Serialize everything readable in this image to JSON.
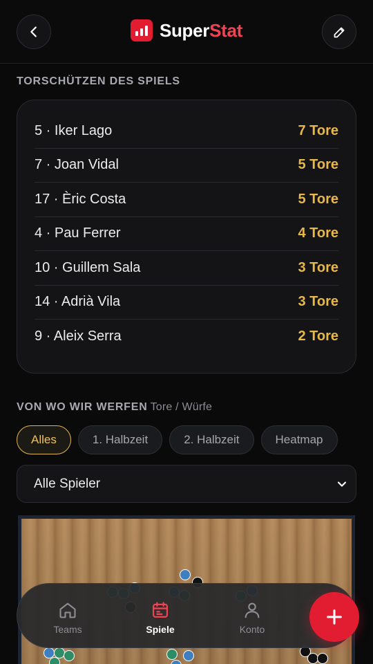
{
  "header": {
    "brand_part1": "Super",
    "brand_part2": "Stat",
    "back_icon": "chevron-left-icon",
    "edit_icon": "pencil-icon",
    "logo_icon": "bar-chart-icon"
  },
  "scorers": {
    "title": "TORSCHÜTZEN DES SPIELS",
    "rows": [
      {
        "player": "5 · Iker Lago",
        "goals": "7 Tore"
      },
      {
        "player": "7 · Joan Vidal",
        "goals": "5 Tore"
      },
      {
        "player": "17 · Èric Costa",
        "goals": "5 Tore"
      },
      {
        "player": "4 · Pau Ferrer",
        "goals": "4 Tore"
      },
      {
        "player": "10 · Guillem Sala",
        "goals": "3 Tore"
      },
      {
        "player": "14 · Adrià Vila",
        "goals": "3 Tore"
      },
      {
        "player": "9 · Aleix Serra",
        "goals": "2 Tore"
      }
    ]
  },
  "shots": {
    "title": "VON WO WIR WERFEN",
    "subtitle": "Tore / Würfe",
    "filters": [
      {
        "label": "Alles",
        "active": true
      },
      {
        "label": "1. Halbzeit",
        "active": false
      },
      {
        "label": "2. Halbzeit",
        "active": false
      },
      {
        "label": "Heatmap",
        "active": false
      }
    ],
    "player_select": "Alle Spieler"
  },
  "nav": {
    "teams": "Teams",
    "spiele": "Spiele",
    "konto": "Konto",
    "active": "spiele"
  },
  "colors": {
    "accent_red": "#e21d32",
    "goals_gold": "#e8b84a",
    "goal_marker": "#3f7fc0",
    "miss_marker": "#111111",
    "save_marker": "#2d8d67"
  }
}
